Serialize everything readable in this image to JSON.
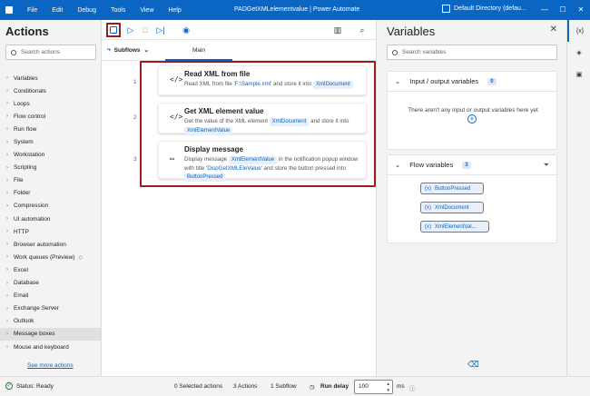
{
  "titlebar": {
    "menu": [
      "File",
      "Edit",
      "Debug",
      "Tools",
      "View",
      "Help"
    ],
    "title": "PADGetXMLelementvalue | Power Automate",
    "directory": "Default Directory (defau..."
  },
  "actions_pane": {
    "title": "Actions",
    "search_placeholder": "Search actions",
    "items": [
      "Variables",
      "Conditionals",
      "Loops",
      "Flow control",
      "Run flow",
      "System",
      "Workstation",
      "Scripting",
      "File",
      "Folder",
      "Compression",
      "UI automation",
      "HTTP",
      "Browser automation",
      "Work queues (Preview)",
      "Excel",
      "Database",
      "Email",
      "Exchange Server",
      "Outlook",
      "Message boxes",
      "Mouse and keyboard"
    ],
    "see_more": "See more actions"
  },
  "tabs": {
    "subflows": "Subflows",
    "main": "Main"
  },
  "flow": {
    "steps": [
      {
        "num": "1",
        "title": "Read XML from file",
        "parts": [
          "Read XML from file ",
          "'F:\\Sample.xml'",
          " and store it into ",
          "XmlDocument",
          ""
        ]
      },
      {
        "num": "2",
        "title": "Get XML element value",
        "parts": [
          "Get the value of the XML element ",
          "XmlDocument",
          " and store it into ",
          "XmlElementValue",
          ""
        ]
      },
      {
        "num": "3",
        "title": "Display message",
        "desc_a": "Display message ",
        "chip_a": "XmlElementValue",
        "desc_b": " in the notification popup window with title ",
        "title_str": "'DispGetXMLEleValue'",
        "desc_c": " and store the button pressed into ",
        "chip_b": "ButtonPressed"
      }
    ]
  },
  "variables_pane": {
    "title": "Variables",
    "search_placeholder": "Search variables",
    "io_section": {
      "title": "Input / output variables",
      "count": "0",
      "empty_text": "There aren't any input or output variables here yet"
    },
    "flow_section": {
      "title": "Flow variables",
      "count": "3",
      "vars": [
        "ButtonPressed",
        "XmlDocument",
        "XmlElementVal..."
      ]
    }
  },
  "rail": {
    "vars_icon_label": "{x}"
  },
  "status": {
    "ready": "Status: Ready",
    "selected": "0 Selected actions",
    "actions": "3 Actions",
    "subflow": "1 Subflow",
    "run_delay_label": "Run delay",
    "run_delay_value": "100",
    "unit": "ms"
  }
}
